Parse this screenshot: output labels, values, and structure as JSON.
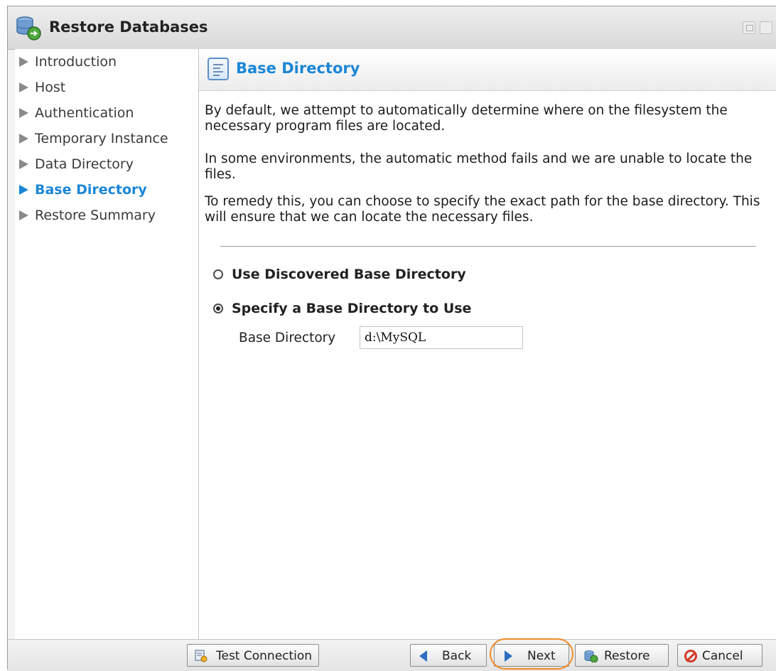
{
  "window": {
    "title": "Restore Databases",
    "icon": "database-restore-icon"
  },
  "nav": {
    "items": [
      {
        "label": "Introduction",
        "active": false
      },
      {
        "label": "Host",
        "active": false
      },
      {
        "label": "Authentication",
        "active": false
      },
      {
        "label": "Temporary Instance",
        "active": false
      },
      {
        "label": "Data Directory",
        "active": false
      },
      {
        "label": "Base Directory",
        "active": true
      },
      {
        "label": "Restore Summary",
        "active": false
      }
    ]
  },
  "main": {
    "section_title": "Base Directory",
    "section_icon": "document-list-icon",
    "paragraphs": [
      "By default, we attempt to automatically determine where on the filesystem the necessary program files are located.",
      "In some environments, the automatic method fails and we are unable to locate the files.",
      "To remedy this, you can choose to specify the exact path for the base directory. This will ensure that we can locate the necessary files."
    ],
    "options": [
      {
        "label": "Use Discovered Base Directory",
        "checked": false
      },
      {
        "label": "Specify a Base Directory to Use",
        "checked": true
      }
    ],
    "field": {
      "label": "Base Directory",
      "value": "d:\\MySQL"
    }
  },
  "footer": {
    "test_connection": "Test Connection",
    "back": "Back",
    "next": "Next",
    "restore": "Restore",
    "cancel": "Cancel"
  },
  "colors": {
    "accent": "#1b86d6",
    "highlight": "#f08c28",
    "cancel": "#d23b2a"
  }
}
